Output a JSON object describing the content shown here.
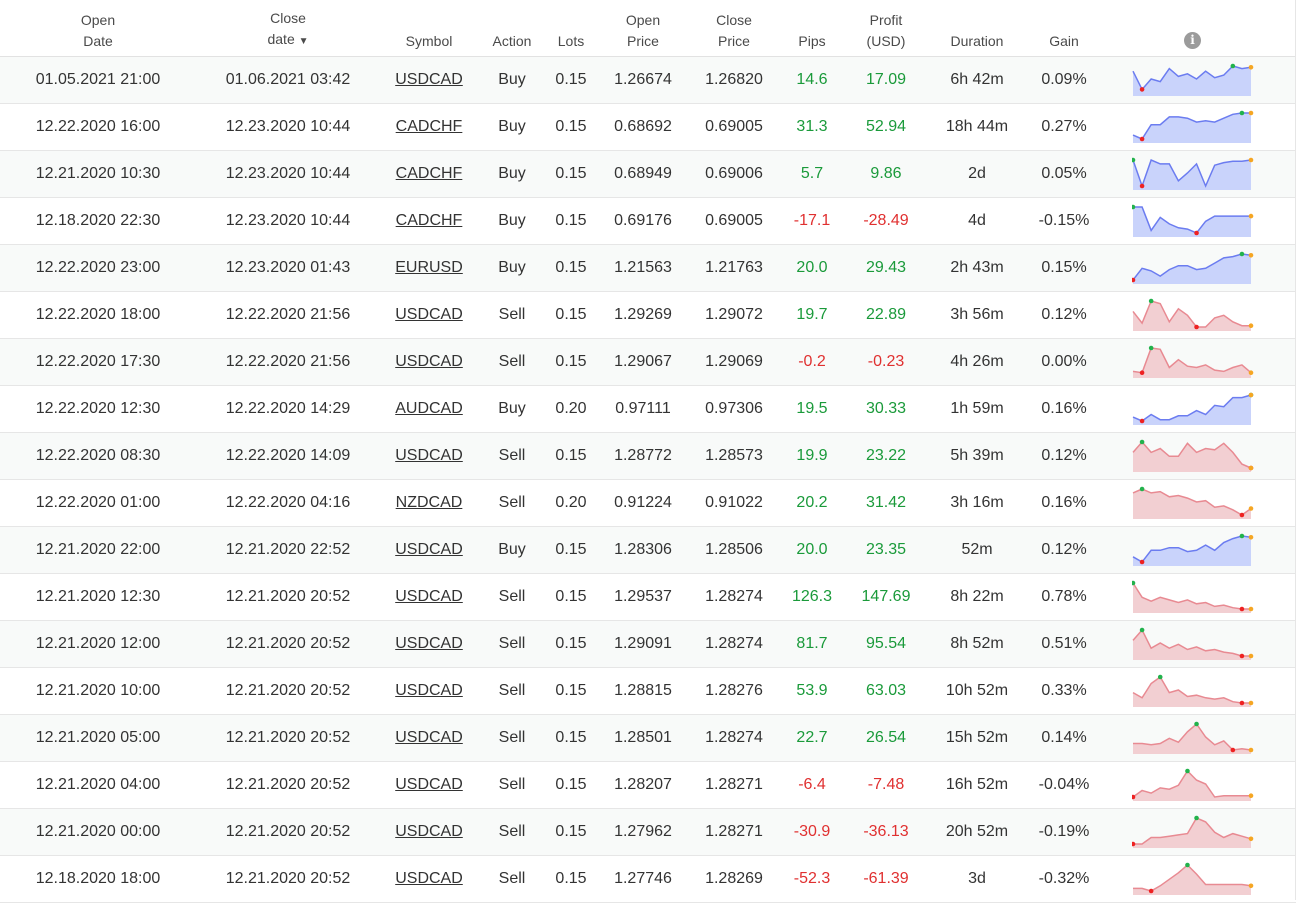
{
  "headers": {
    "open_date_1": "Open",
    "open_date_2": "Date",
    "close_date_1": "Close",
    "close_date_2": "date",
    "close_sort_glyph": "▼",
    "symbol": "Symbol",
    "action": "Action",
    "lots": "Lots",
    "open_price_1": "Open",
    "open_price_2": "Price",
    "close_price_1": "Close",
    "close_price_2": "Price",
    "pips": "Pips",
    "profit_1": "Profit",
    "profit_2": "(USD)",
    "duration": "Duration",
    "gain": "Gain",
    "info_icon": "i"
  },
  "colors": {
    "positive": "#1a9a3a",
    "negative": "#e03030",
    "buy_fill": "#c9d3fb",
    "buy_line": "#6b7cf0",
    "sell_fill": "#f2cfd2",
    "sell_line": "#e88a92",
    "marker_high": "#22b24c",
    "marker_low": "#ee2222",
    "marker_end": "#f5a623"
  },
  "rows": [
    {
      "open_date": "01.05.2021 21:00",
      "close_date": "01.06.2021 03:42",
      "symbol": "USDCAD",
      "action": "Buy",
      "lots": "0.15",
      "open_price": "1.26674",
      "close_price": "1.26820",
      "pips": "14.6",
      "profit": "17.09",
      "duration": "6h 42m",
      "gain": "0.09%",
      "spark": [
        0.2,
        0.9,
        0.5,
        0.6,
        0.1,
        0.4,
        0.3,
        0.5,
        0.2,
        0.45,
        0.35,
        0.0,
        0.1,
        0.05
      ]
    },
    {
      "open_date": "12.22.2020 16:00",
      "close_date": "12.23.2020 10:44",
      "symbol": "CADCHF",
      "action": "Buy",
      "lots": "0.15",
      "open_price": "0.68692",
      "close_price": "0.69005",
      "pips": "31.3",
      "profit": "52.94",
      "duration": "18h 44m",
      "gain": "0.27%",
      "spark": [
        0.85,
        1.0,
        0.45,
        0.45,
        0.15,
        0.15,
        0.2,
        0.35,
        0.3,
        0.35,
        0.2,
        0.05,
        0.0,
        0.0
      ]
    },
    {
      "open_date": "12.21.2020 10:30",
      "close_date": "12.23.2020 10:44",
      "symbol": "CADCHF",
      "action": "Buy",
      "lots": "0.15",
      "open_price": "0.68949",
      "close_price": "0.69006",
      "pips": "5.7",
      "profit": "9.86",
      "duration": "2d",
      "gain": "0.05%",
      "spark": [
        0.0,
        1.0,
        0.0,
        0.15,
        0.15,
        0.8,
        0.5,
        0.15,
        1.0,
        0.2,
        0.1,
        0.05,
        0.05,
        0.0
      ]
    },
    {
      "open_date": "12.18.2020 22:30",
      "close_date": "12.23.2020 10:44",
      "symbol": "CADCHF",
      "action": "Buy",
      "lots": "0.15",
      "open_price": "0.69176",
      "close_price": "0.69005",
      "pips": "-17.1",
      "profit": "-28.49",
      "duration": "4d",
      "gain": "-0.15%",
      "spark": [
        0.0,
        0.0,
        0.9,
        0.4,
        0.65,
        0.8,
        0.85,
        1.0,
        0.55,
        0.35,
        0.35,
        0.35,
        0.35,
        0.35
      ]
    },
    {
      "open_date": "12.22.2020 23:00",
      "close_date": "12.23.2020 01:43",
      "symbol": "EURUSD",
      "action": "Buy",
      "lots": "0.15",
      "open_price": "1.21563",
      "close_price": "1.21763",
      "pips": "20.0",
      "profit": "29.43",
      "duration": "2h 43m",
      "gain": "0.15%",
      "spark": [
        1.0,
        0.55,
        0.65,
        0.85,
        0.6,
        0.45,
        0.45,
        0.6,
        0.55,
        0.35,
        0.15,
        0.1,
        0.0,
        0.05
      ]
    },
    {
      "open_date": "12.22.2020 18:00",
      "close_date": "12.22.2020 21:56",
      "symbol": "USDCAD",
      "action": "Sell",
      "lots": "0.15",
      "open_price": "1.29269",
      "close_price": "1.29072",
      "pips": "19.7",
      "profit": "22.89",
      "duration": "3h 56m",
      "gain": "0.12%",
      "spark": [
        0.4,
        0.85,
        0.0,
        0.1,
        0.8,
        0.3,
        0.55,
        1.0,
        1.0,
        0.65,
        0.55,
        0.8,
        0.95,
        0.95
      ]
    },
    {
      "open_date": "12.22.2020 17:30",
      "close_date": "12.22.2020 21:56",
      "symbol": "USDCAD",
      "action": "Sell",
      "lots": "0.15",
      "open_price": "1.29067",
      "close_price": "1.29069",
      "pips": "-0.2",
      "profit": "-0.23",
      "duration": "4h 26m",
      "gain": "0.00%",
      "spark": [
        0.9,
        0.95,
        0.0,
        0.05,
        0.75,
        0.45,
        0.7,
        0.75,
        0.65,
        0.85,
        0.9,
        0.75,
        0.65,
        0.95
      ]
    },
    {
      "open_date": "12.22.2020 12:30",
      "close_date": "12.22.2020 14:29",
      "symbol": "AUDCAD",
      "action": "Buy",
      "lots": "0.20",
      "open_price": "0.97111",
      "close_price": "0.97306",
      "pips": "19.5",
      "profit": "30.33",
      "duration": "1h 59m",
      "gain": "0.16%",
      "spark": [
        0.85,
        1.0,
        0.75,
        0.95,
        0.95,
        0.8,
        0.8,
        0.6,
        0.75,
        0.4,
        0.45,
        0.1,
        0.1,
        0.0
      ]
    },
    {
      "open_date": "12.22.2020 08:30",
      "close_date": "12.22.2020 14:09",
      "symbol": "USDCAD",
      "action": "Sell",
      "lots": "0.15",
      "open_price": "1.28772",
      "close_price": "1.28573",
      "pips": "19.9",
      "profit": "23.22",
      "duration": "5h 39m",
      "gain": "0.12%",
      "spark": [
        0.4,
        0.0,
        0.4,
        0.25,
        0.55,
        0.55,
        0.05,
        0.4,
        0.25,
        0.3,
        0.05,
        0.4,
        0.85,
        1.0
      ]
    },
    {
      "open_date": "12.22.2020 01:00",
      "close_date": "12.22.2020 04:16",
      "symbol": "NZDCAD",
      "action": "Sell",
      "lots": "0.20",
      "open_price": "0.91224",
      "close_price": "0.91022",
      "pips": "20.2",
      "profit": "31.42",
      "duration": "3h 16m",
      "gain": "0.16%",
      "spark": [
        0.15,
        0.0,
        0.15,
        0.1,
        0.3,
        0.25,
        0.35,
        0.5,
        0.45,
        0.7,
        0.65,
        0.8,
        1.0,
        0.75
      ]
    },
    {
      "open_date": "12.21.2020 22:00",
      "close_date": "12.21.2020 22:52",
      "symbol": "USDCAD",
      "action": "Buy",
      "lots": "0.15",
      "open_price": "1.28306",
      "close_price": "1.28506",
      "pips": "20.0",
      "profit": "23.35",
      "duration": "52m",
      "gain": "0.12%",
      "spark": [
        0.8,
        1.0,
        0.55,
        0.55,
        0.45,
        0.45,
        0.6,
        0.55,
        0.35,
        0.55,
        0.25,
        0.1,
        0.0,
        0.05
      ]
    },
    {
      "open_date": "12.21.2020 12:30",
      "close_date": "12.21.2020 20:52",
      "symbol": "USDCAD",
      "action": "Sell",
      "lots": "0.15",
      "open_price": "1.29537",
      "close_price": "1.28274",
      "pips": "126.3",
      "profit": "147.69",
      "duration": "8h 22m",
      "gain": "0.78%",
      "spark": [
        0.0,
        0.55,
        0.7,
        0.55,
        0.65,
        0.75,
        0.65,
        0.8,
        0.75,
        0.9,
        0.85,
        0.95,
        1.0,
        1.0
      ]
    },
    {
      "open_date": "12.21.2020 12:00",
      "close_date": "12.21.2020 20:52",
      "symbol": "USDCAD",
      "action": "Sell",
      "lots": "0.15",
      "open_price": "1.29091",
      "close_price": "1.28274",
      "pips": "81.7",
      "profit": "95.54",
      "duration": "8h 52m",
      "gain": "0.51%",
      "spark": [
        0.4,
        0.0,
        0.7,
        0.5,
        0.7,
        0.55,
        0.75,
        0.65,
        0.8,
        0.75,
        0.85,
        0.9,
        1.0,
        1.0
      ]
    },
    {
      "open_date": "12.21.2020 10:00",
      "close_date": "12.21.2020 20:52",
      "symbol": "USDCAD",
      "action": "Sell",
      "lots": "0.15",
      "open_price": "1.28815",
      "close_price": "1.28276",
      "pips": "53.9",
      "profit": "63.03",
      "duration": "10h 52m",
      "gain": "0.33%",
      "spark": [
        0.6,
        0.8,
        0.25,
        0.0,
        0.6,
        0.5,
        0.75,
        0.7,
        0.8,
        0.85,
        0.8,
        0.95,
        1.0,
        1.0
      ]
    },
    {
      "open_date": "12.21.2020 05:00",
      "close_date": "12.21.2020 20:52",
      "symbol": "USDCAD",
      "action": "Sell",
      "lots": "0.15",
      "open_price": "1.28501",
      "close_price": "1.28274",
      "pips": "22.7",
      "profit": "26.54",
      "duration": "15h 52m",
      "gain": "0.14%",
      "spark": [
        0.75,
        0.75,
        0.8,
        0.75,
        0.55,
        0.7,
        0.3,
        0.0,
        0.5,
        0.8,
        0.65,
        1.0,
        0.95,
        1.0
      ]
    },
    {
      "open_date": "12.21.2020 04:00",
      "close_date": "12.21.2020 20:52",
      "symbol": "USDCAD",
      "action": "Sell",
      "lots": "0.15",
      "open_price": "1.28207",
      "close_price": "1.28271",
      "pips": "-6.4",
      "profit": "-7.48",
      "duration": "16h 52m",
      "gain": "-0.04%",
      "spark": [
        1.0,
        0.75,
        0.85,
        0.65,
        0.7,
        0.55,
        0.0,
        0.35,
        0.5,
        1.0,
        0.95,
        0.95,
        0.95,
        0.95
      ]
    },
    {
      "open_date": "12.21.2020 00:00",
      "close_date": "12.21.2020 20:52",
      "symbol": "USDCAD",
      "action": "Sell",
      "lots": "0.15",
      "open_price": "1.27962",
      "close_price": "1.28271",
      "pips": "-30.9",
      "profit": "-36.13",
      "duration": "20h 52m",
      "gain": "-0.19%",
      "spark": [
        1.0,
        1.0,
        0.75,
        0.75,
        0.7,
        0.65,
        0.6,
        0.0,
        0.15,
        0.55,
        0.75,
        0.6,
        0.7,
        0.8
      ]
    },
    {
      "open_date": "12.18.2020 18:00",
      "close_date": "12.21.2020 20:52",
      "symbol": "USDCAD",
      "action": "Sell",
      "lots": "0.15",
      "open_price": "1.27746",
      "close_price": "1.28269",
      "pips": "-52.3",
      "profit": "-61.39",
      "duration": "3d",
      "gain": "-0.32%",
      "spark": [
        0.9,
        0.9,
        1.0,
        0.8,
        0.55,
        0.3,
        0.0,
        0.35,
        0.75,
        0.75,
        0.75,
        0.75,
        0.75,
        0.8
      ]
    }
  ]
}
